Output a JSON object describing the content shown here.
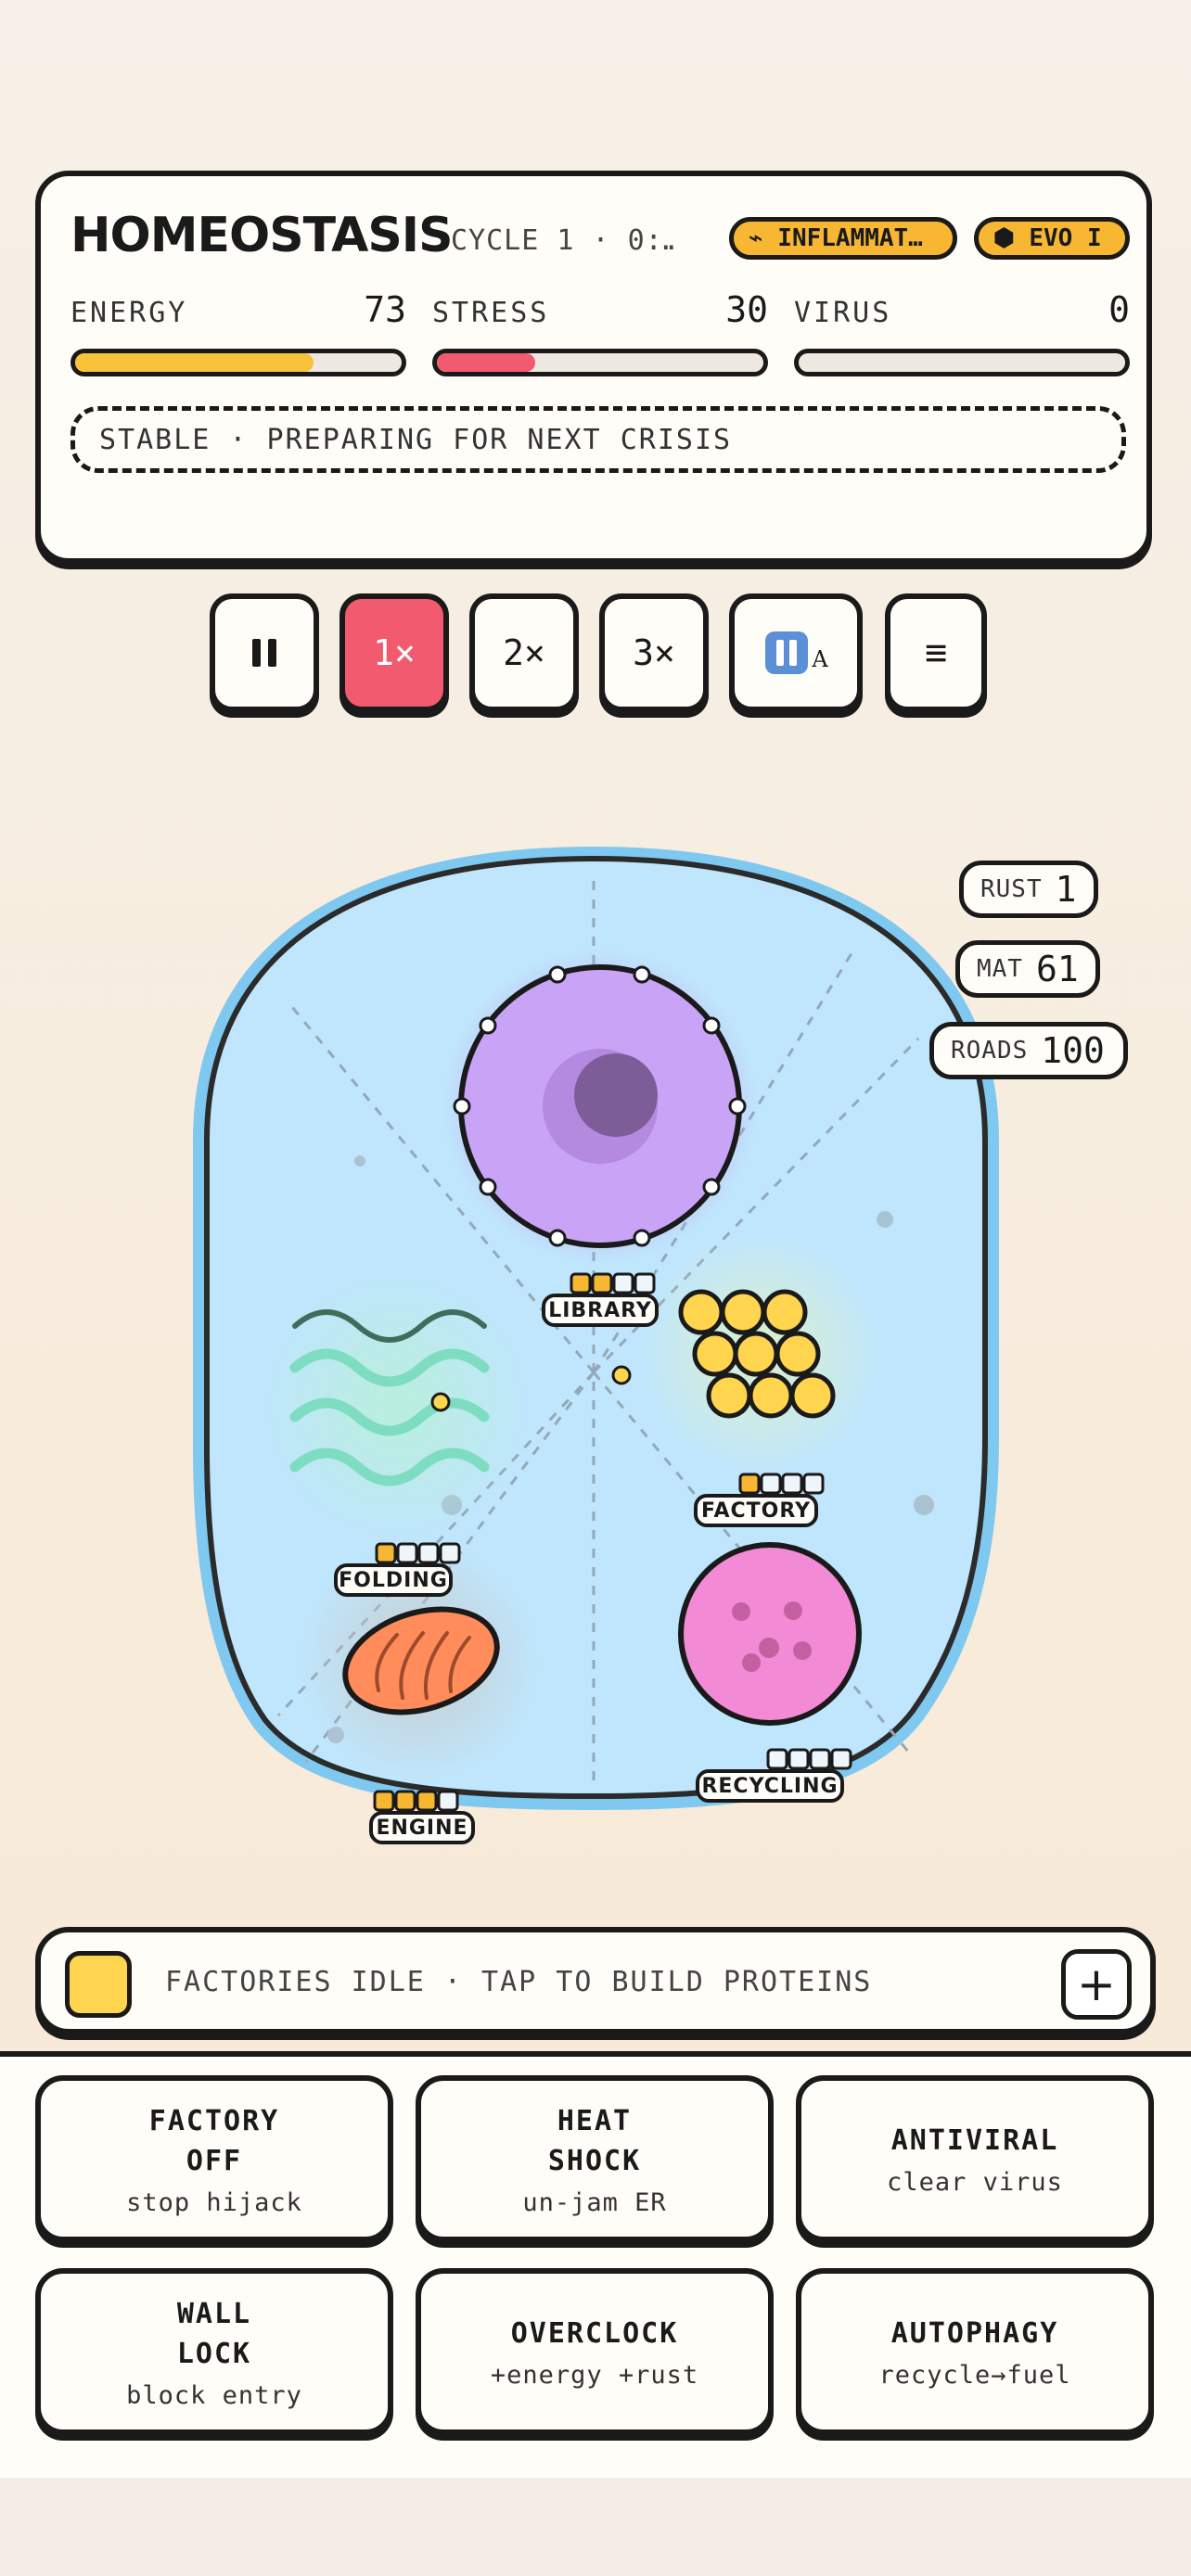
{
  "header": {
    "title": "HOMEOSTASIS",
    "cycle": "CYCLE 1 · 0:…",
    "badge_inflammation": "⌁ INFLAMMAT…",
    "badge_evo": "⬢ EVO I",
    "badge_color": "#f7b733"
  },
  "meters": {
    "energy": {
      "label": "ENERGY",
      "value": "73",
      "fraction": 0.73,
      "color": "#f8c23a"
    },
    "stress": {
      "label": "STRESS",
      "value": "30",
      "fraction": 0.3,
      "color": "#f25a70"
    },
    "virus": {
      "label": "VIRUS",
      "value": "0",
      "fraction": 0.0,
      "color": "#9ad0f5"
    }
  },
  "status_message": "STABLE · PREPARING FOR NEXT CRISIS",
  "controls": {
    "pause_icon": "pause-icon",
    "speed1": "1×",
    "speed2": "2×",
    "speed3": "3×",
    "autopause_icon": "auto-pause-icon",
    "autopause_suffix": "A",
    "menu_icon": "menu-icon",
    "menu_glyph": "≡",
    "active_color": "#f25a70"
  },
  "resources": {
    "rust": {
      "label": "RUST",
      "value": "1"
    },
    "mat": {
      "label": "MAT",
      "value": "61"
    },
    "roads": {
      "label": "ROADS",
      "value": "100"
    }
  },
  "organelles": {
    "library": {
      "label": "LIBRARY",
      "level": 2,
      "slots": 4,
      "color": "#c9a3f5"
    },
    "factory": {
      "label": "FACTORY",
      "level": 1,
      "slots": 4,
      "color": "#ffd54f"
    },
    "folding": {
      "label": "FOLDING",
      "level": 1,
      "slots": 4,
      "color": "#7edcc0"
    },
    "recycling": {
      "label": "RECYCLING",
      "level": 0,
      "slots": 4,
      "color": "#f28ad6"
    },
    "engine": {
      "label": "ENGINE",
      "level": 3,
      "slots": 4,
      "color": "#ff8c5a"
    }
  },
  "cell": {
    "membrane_color": "#7fc8f0",
    "cytoplasm_color": "#bfe6fc"
  },
  "build_bar": {
    "text": "FACTORIES IDLE · TAP TO BUILD PROTEINS",
    "add_glyph": "+",
    "swatch_color": "#ffd54f"
  },
  "actions": [
    {
      "title": "FACTORY\nOFF",
      "sub": "stop hijack"
    },
    {
      "title": "HEAT\nSHOCK",
      "sub": "un-jam ER"
    },
    {
      "title": "ANTIVIRAL",
      "sub": "clear virus"
    },
    {
      "title": "WALL\nLOCK",
      "sub": "block entry"
    },
    {
      "title": "OVERCLOCK",
      "sub": "+energy +rust"
    },
    {
      "title": "AUTOPHAGY",
      "sub": "recycle→fuel"
    }
  ]
}
